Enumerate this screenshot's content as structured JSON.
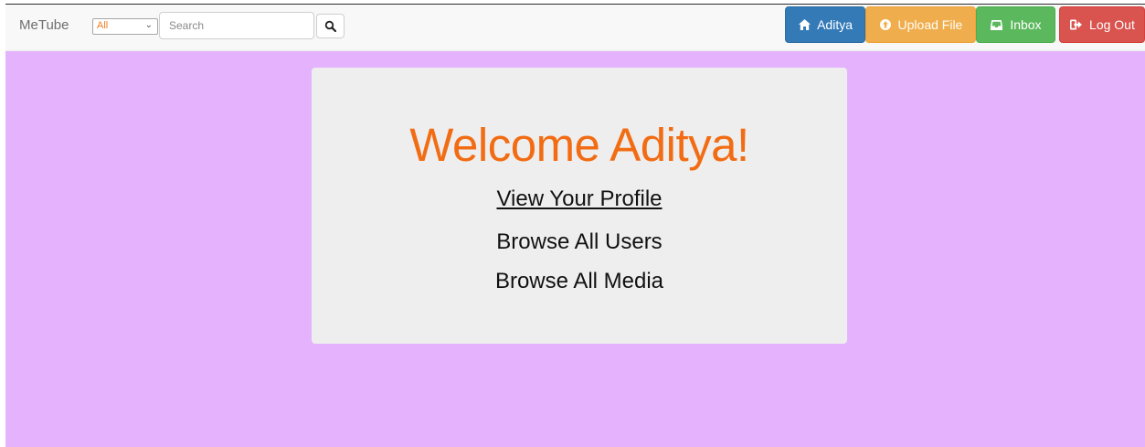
{
  "navbar": {
    "brand": "MeTube",
    "filter": {
      "selected": "All"
    },
    "search": {
      "placeholder": "Search",
      "value": ""
    },
    "buttons": {
      "home": {
        "label": "Aditya",
        "icon": "home-icon",
        "color": "#337ab7"
      },
      "upload": {
        "label": "Upload File",
        "icon": "upload-icon",
        "color": "#f0ad4e"
      },
      "inbox": {
        "label": "Inbox",
        "icon": "inbox-icon",
        "color": "#5cb85c"
      },
      "logout": {
        "label": "Log Out",
        "icon": "logout-icon",
        "color": "#d9534f"
      }
    }
  },
  "main": {
    "background": "#e5b3fd",
    "welcome": "Welcome Aditya!",
    "links": [
      {
        "label": "View Your Profile"
      },
      {
        "label": "Browse All Users"
      },
      {
        "label": "Browse All Media"
      }
    ],
    "accent": "#f26c13"
  }
}
